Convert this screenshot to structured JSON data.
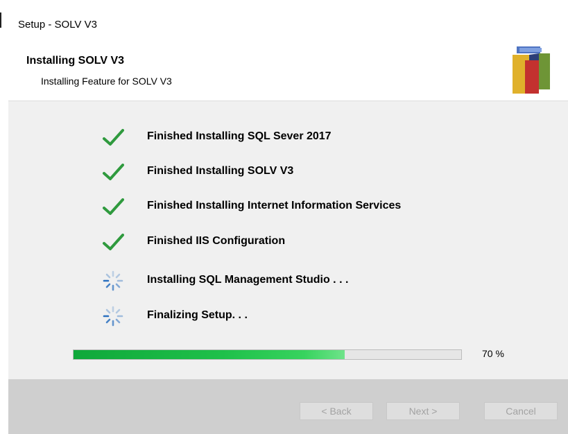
{
  "window": {
    "title": "Setup - SOLV V3"
  },
  "header": {
    "title": "Installing SOLV V3",
    "subtitle": "Installing Feature for SOLV V3",
    "logo_colors": [
      "#4f74c2",
      "#e0b12b",
      "#c3312f",
      "#6e9536"
    ]
  },
  "steps": [
    {
      "label": "Finished Installing SQL Sever 2017",
      "status": "done",
      "icon": "check-icon"
    },
    {
      "label": "Finished Installing SOLV V3",
      "status": "done",
      "icon": "check-icon"
    },
    {
      "label": "Finished Installing Internet Information Services",
      "status": "done",
      "icon": "check-icon"
    },
    {
      "label": "Finished IIS Configuration",
      "status": "done",
      "icon": "check-icon"
    },
    {
      "label": "Installing SQL Management Studio . . .",
      "status": "in-progress",
      "icon": "spinner-icon"
    },
    {
      "label": "Finalizing Setup. . .",
      "status": "in-progress",
      "icon": "spinner-icon"
    }
  ],
  "progress": {
    "value": 70,
    "label": "70 %"
  },
  "buttons": {
    "back": "< Back",
    "next": "Next >",
    "cancel": "Cancel"
  },
  "colors": {
    "check": "#2f9a3e",
    "spinner": "#2a6fbf",
    "progress_fill": "#1fc04a",
    "footer": "#cfcfcf",
    "content": "#f0f0f0"
  }
}
